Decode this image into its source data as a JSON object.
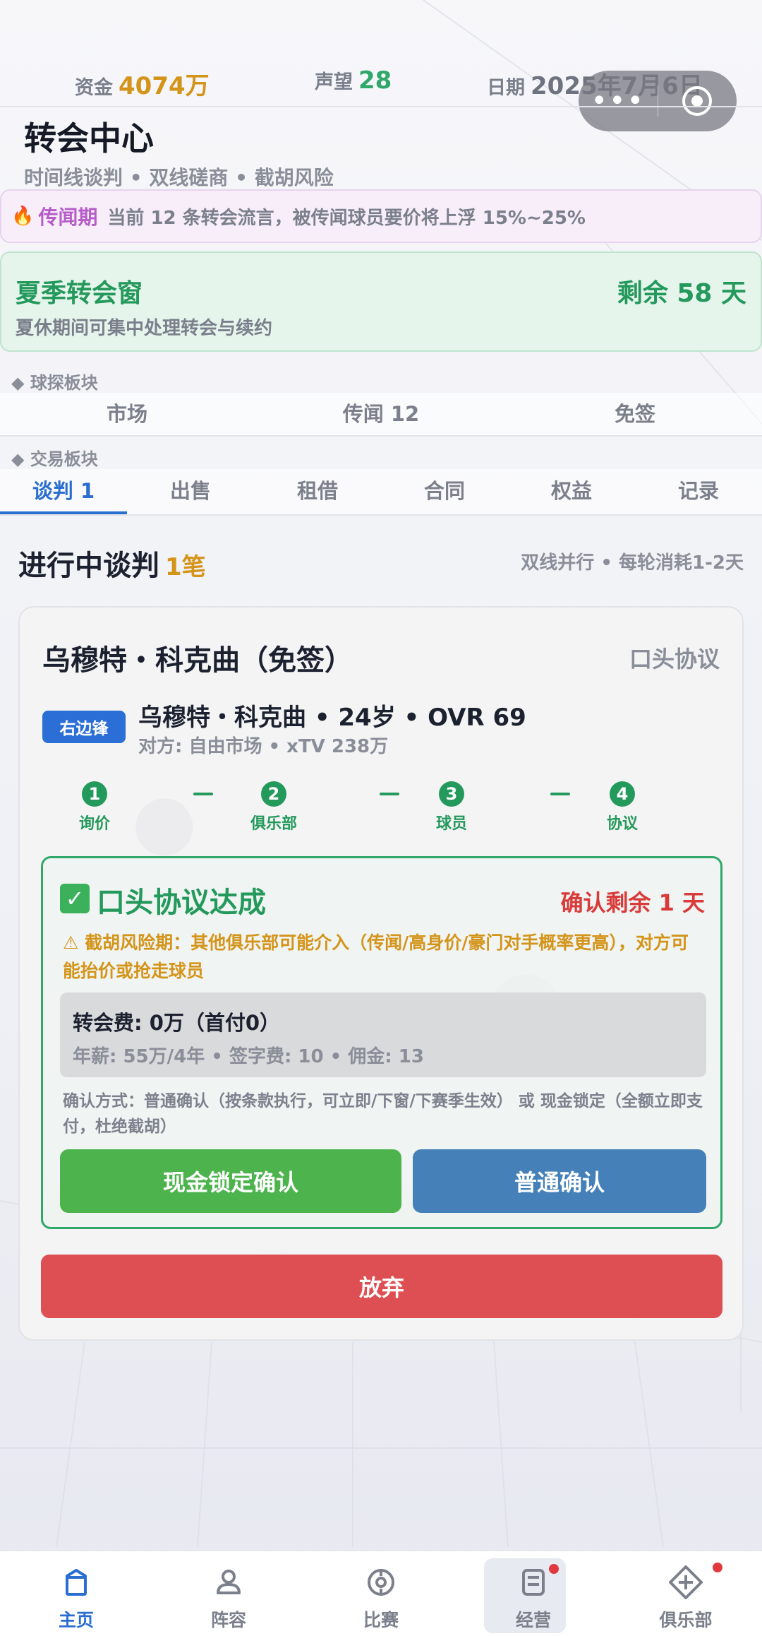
{
  "status": {
    "money_label": "资金",
    "money_value": "4074万",
    "rep_label": "声望",
    "rep_value": "28",
    "date_label": "日期",
    "date_value": "2025年7月6日"
  },
  "capsule": {
    "more_icon": "more-dots-icon",
    "close_icon": "target-close-icon"
  },
  "header": {
    "title": "转会中心",
    "subtitle": "时间线谈判 • 双线磋商 • 截胡风险"
  },
  "rumor": {
    "icon": "fire-icon",
    "tag": "传闻期",
    "text": "当前 12 条转会流言，被传闻球员要价将上浮 15%~25%"
  },
  "window": {
    "title": "夏季转会窗",
    "remaining": "剩余 58 天",
    "desc": "夏休期间可集中处理转会与续约"
  },
  "scout_section": {
    "label": "◆ 球探板块",
    "tabs": [
      "市场",
      "传闻 12",
      "免签"
    ]
  },
  "trade_section": {
    "label": "◆ 交易板块",
    "tabs": [
      "谈判 1",
      "出售",
      "租借",
      "合同",
      "权益",
      "记录"
    ],
    "active_index": 0
  },
  "negotiation": {
    "title": "进行中谈判",
    "count": "1笔",
    "hint": "双线并行 • 每轮消耗1-2天"
  },
  "deal": {
    "title": "乌穆特・科克曲（免签）",
    "status": "口头协议",
    "position": "右边锋",
    "player_line": "乌穆特・科克曲 • 24岁 • OVR 69",
    "meta_line": "对方: 自由市场 • xTV 238万",
    "steps": [
      {
        "num": "1",
        "label": "询价"
      },
      {
        "num": "2",
        "label": "俱乐部"
      },
      {
        "num": "3",
        "label": "球员"
      },
      {
        "num": "4",
        "label": "协议"
      }
    ],
    "step_sep": "—",
    "agreement": {
      "check": "✓",
      "title": "口头协议达成",
      "confirm_remaining": "确认剩余 1 天",
      "warning": "⚠ 截胡风险期：其他俱乐部可能介入（传闻/高身价/豪门对手概率更高），对方可能抬价或抢走球员",
      "fee_line": "转会费: 0万（首付0）",
      "terms_line": "年薪: 55万/4年 • 签字费: 10 • 佣金: 13",
      "confirm_note": "确认方式：普通确认（按条款执行，可立即/下窗/下赛季生效） 或 现金锁定（全额立即支付，杜绝截胡）",
      "cash_lock_button": "现金锁定确认",
      "normal_button": "普通确认"
    },
    "abandon_button": "放弃"
  },
  "nav": {
    "items": [
      {
        "label": "主页",
        "icon": "home-icon"
      },
      {
        "label": "阵容",
        "icon": "lineup-icon"
      },
      {
        "label": "比赛",
        "icon": "match-icon"
      },
      {
        "label": "经营",
        "icon": "manage-icon"
      },
      {
        "label": "俱乐部",
        "icon": "club-icon"
      }
    ],
    "active_index": 0,
    "selected_index": 3
  },
  "colors": {
    "accent_blue": "#2a6ed0",
    "green": "#24995c",
    "gold": "#d4941a",
    "red": "#dd4f52",
    "purple": "#b55cc8"
  }
}
